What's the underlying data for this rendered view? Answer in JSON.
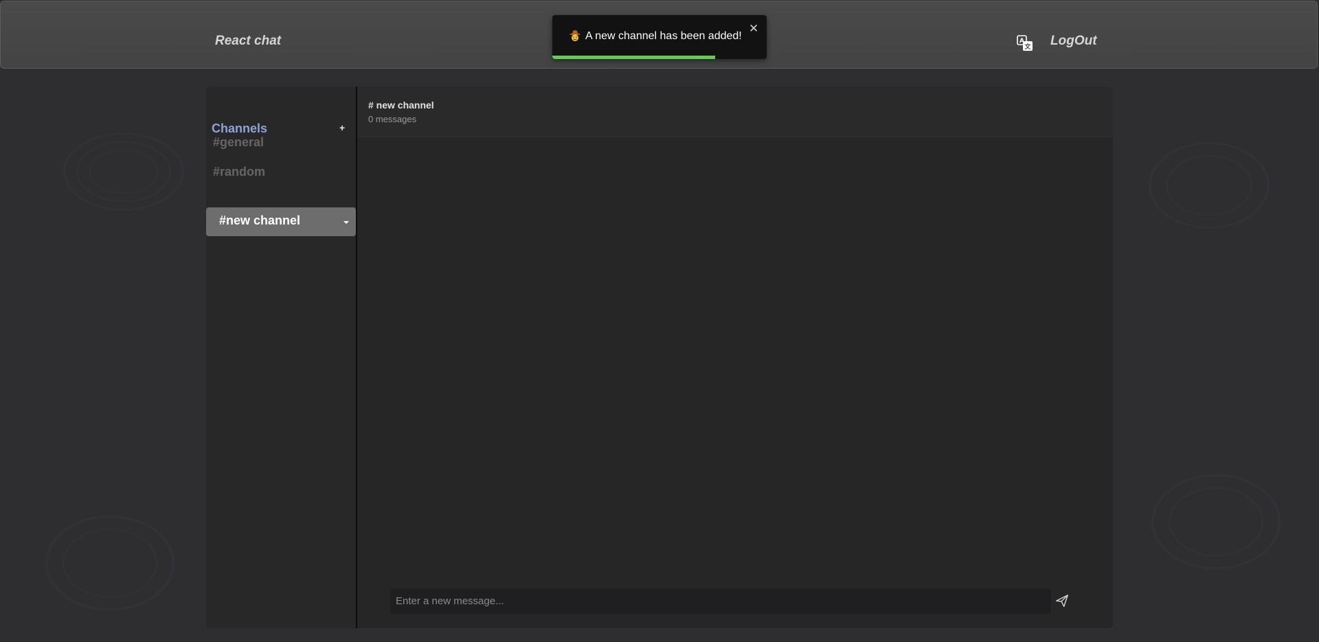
{
  "header": {
    "brand": "React chat",
    "logout_label": "LogOut",
    "translate_icon": "translate-icon"
  },
  "toast": {
    "icon": "cowboy-face-icon",
    "message": "A new channel has been added!",
    "close_label": "✕",
    "progress_fraction": 0.76,
    "progress_color": "#62d04a"
  },
  "sidebar": {
    "title": "Channels",
    "add_label": "+",
    "channels": [
      {
        "label": "#general",
        "active": false
      },
      {
        "label": "#random",
        "active": false
      },
      {
        "label": "#new channel",
        "active": true
      }
    ]
  },
  "chat": {
    "title": "# new channel",
    "message_count": "0 messages",
    "input_placeholder": "Enter a new message...",
    "send_icon": "send-icon"
  },
  "colors": {
    "accent": "#8ea3d8",
    "active_channel_bg": "#6d6d6d",
    "toast_progress": "#62d04a"
  }
}
